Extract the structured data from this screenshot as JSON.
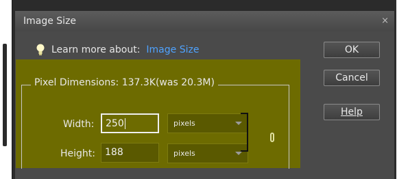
{
  "dialog": {
    "title": "Image Size",
    "close_glyph": "×"
  },
  "learn": {
    "prefix": "Learn more about:",
    "link": "Image Size",
    "icon": "lightbulb-icon"
  },
  "buttons": {
    "ok": "OK",
    "cancel": "Cancel",
    "help": "Help"
  },
  "pixel_dimensions": {
    "legend": "Pixel Dimensions:  137.3K(was 20.3M)",
    "width_label": "Width:",
    "width_value": "250",
    "width_unit": "pixels",
    "height_label": "Height:",
    "height_value": "188",
    "height_unit": "pixels"
  },
  "colors": {
    "dialog_bg": "#4a4a4a",
    "panel_bg": "#6d6b00",
    "link": "#4fa3ff"
  }
}
